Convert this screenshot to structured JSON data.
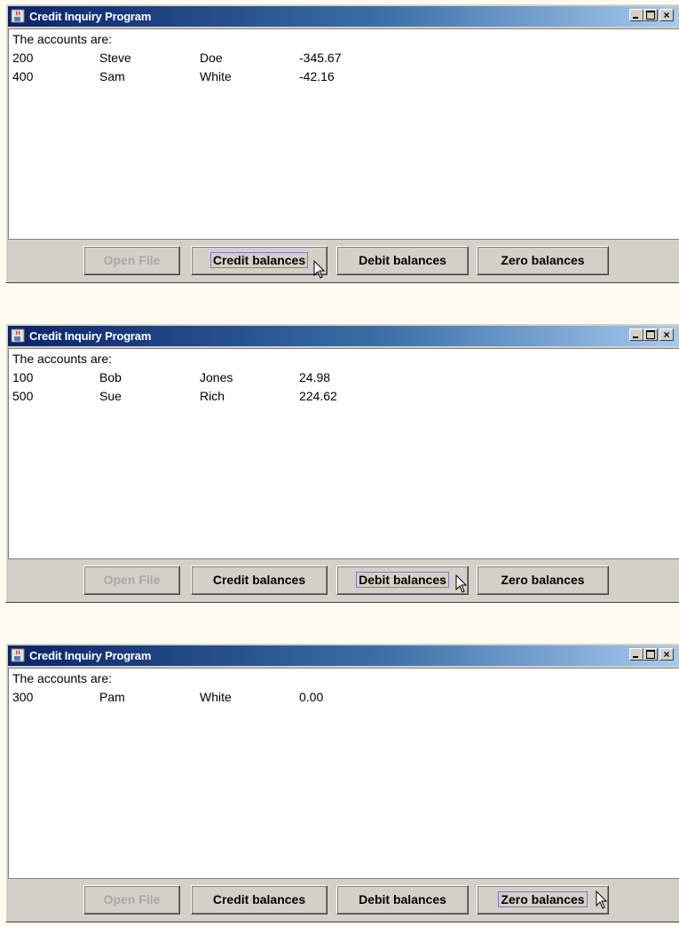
{
  "windows": [
    {
      "title": "Credit Inquiry Program",
      "header": "The accounts are:",
      "rows": [
        [
          "200",
          "Steve",
          "Doe",
          "-345.67"
        ],
        [
          "400",
          "Sam",
          "White",
          "-42.16"
        ]
      ],
      "buttons": {
        "open": "Open File",
        "credit": "Credit balances",
        "debit": "Debit balances",
        "zero": "Zero balances"
      },
      "focused": "credit"
    },
    {
      "title": "Credit Inquiry Program",
      "header": "The accounts are:",
      "rows": [
        [
          "100",
          "Bob",
          "Jones",
          "24.98"
        ],
        [
          "500",
          "Sue",
          "Rich",
          "224.62"
        ]
      ],
      "buttons": {
        "open": "Open File",
        "credit": "Credit balances",
        "debit": "Debit balances",
        "zero": "Zero balances"
      },
      "focused": "debit"
    },
    {
      "title": "Credit Inquiry Program",
      "header": "The accounts are:",
      "rows": [
        [
          "300",
          "Pam",
          "White",
          "0.00"
        ]
      ],
      "buttons": {
        "open": "Open File",
        "credit": "Credit balances",
        "debit": "Debit balances",
        "zero": "Zero balances"
      },
      "focused": "zero"
    }
  ],
  "icons": {
    "app": "java-cup-icon",
    "minimize": "minimize-icon",
    "maximize": "maximize-icon",
    "close": "close-icon",
    "cursor": "mouse-pointer-icon"
  },
  "colors": {
    "titlebar_start": "#0a246a",
    "titlebar_end": "#a6caf0",
    "face": "#d4d0c8",
    "background": "#fffbee"
  }
}
